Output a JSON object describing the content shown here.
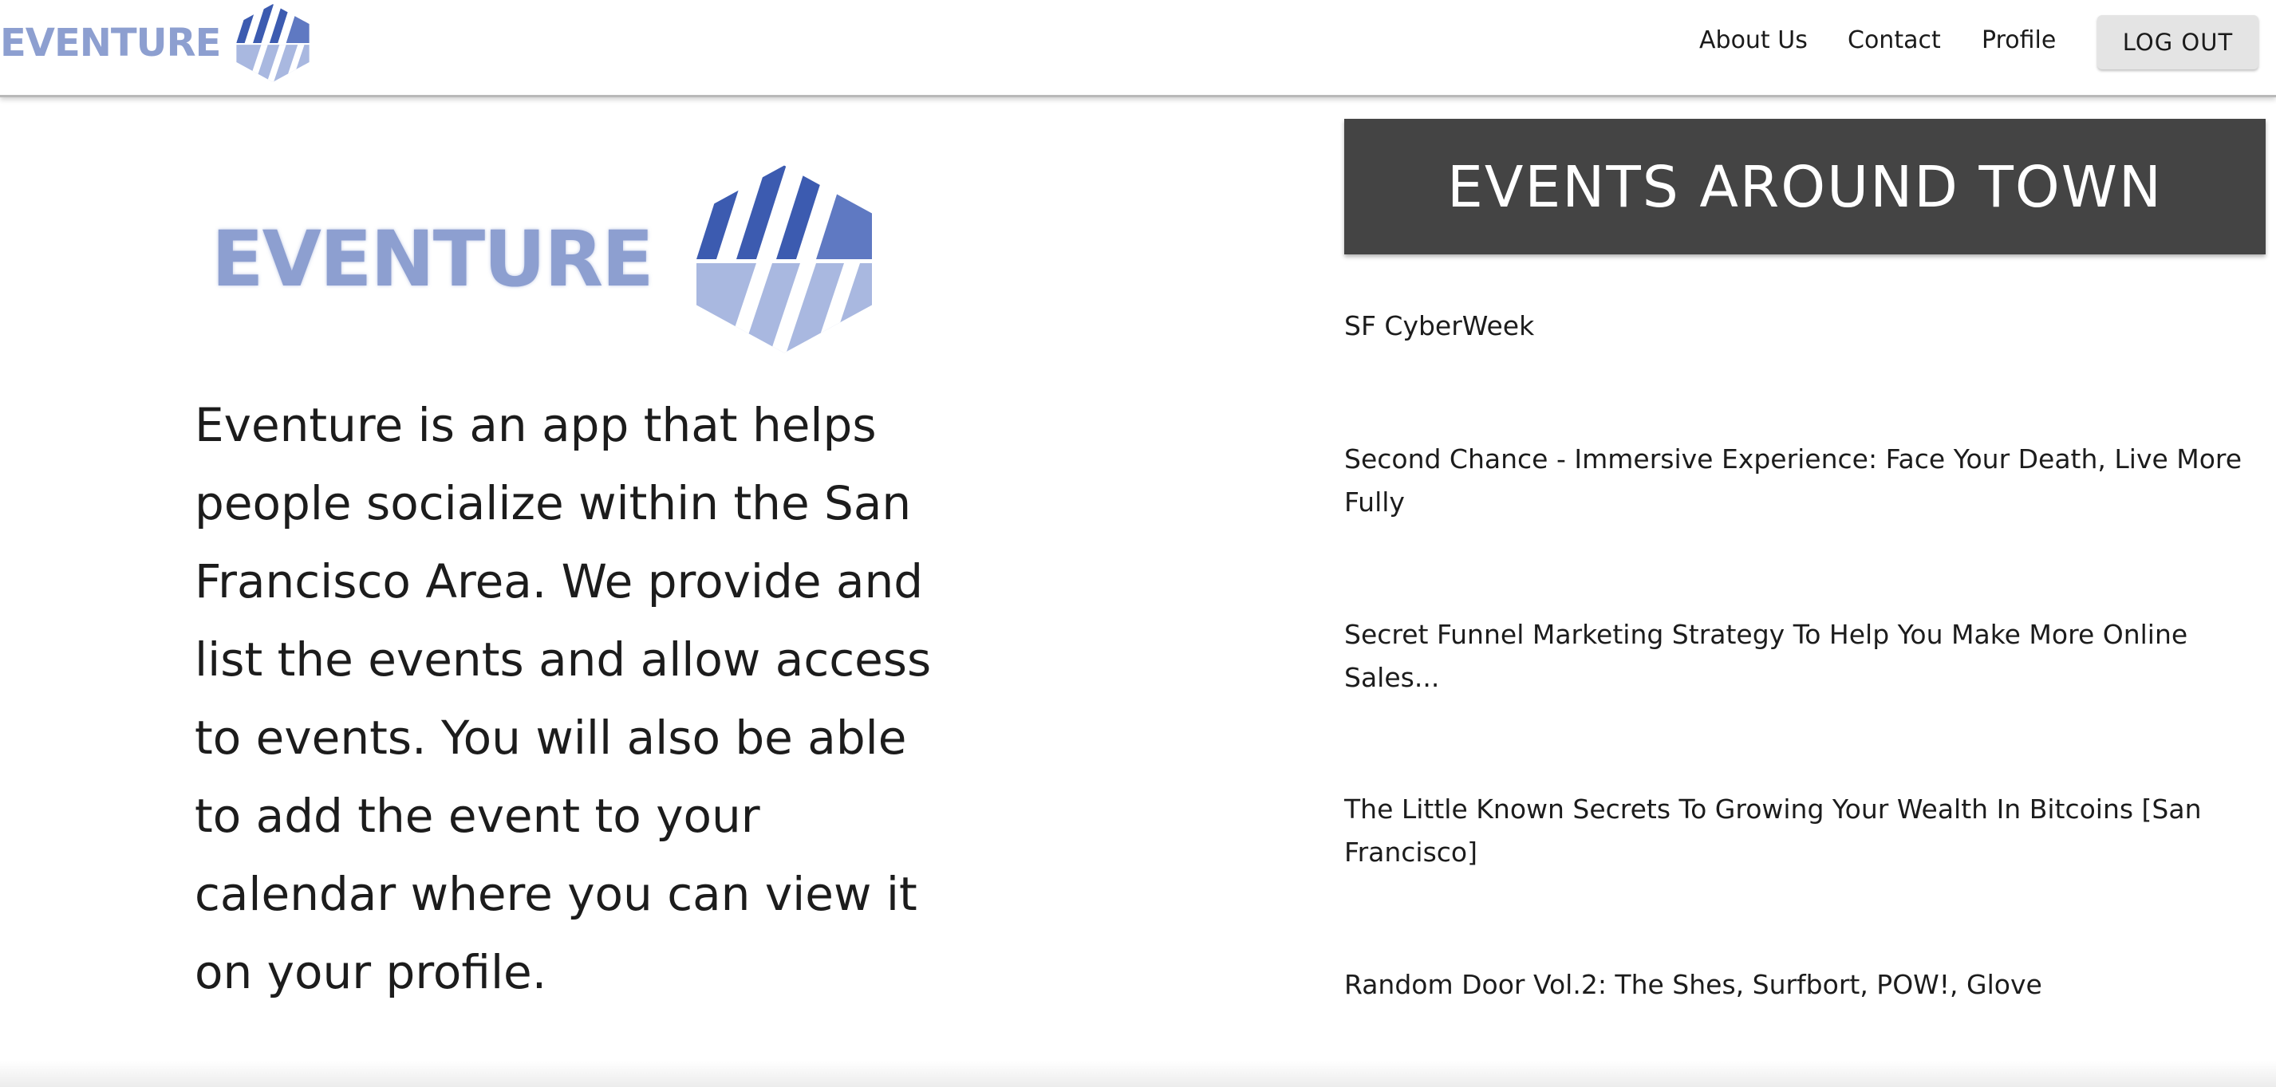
{
  "navbar": {
    "brand_text": "EVENTURE",
    "links": [
      "About Us",
      "Contact",
      "Profile"
    ],
    "logout_label": "LOG OUT"
  },
  "hero": {
    "logo_text": "EVENTURE",
    "description": "Eventure is an app that helps people socialize within the San Francisco Area. We provide and list the events and allow access to events. You will also be able to add the event to your calendar where you can view it on your profile."
  },
  "events": {
    "heading": "EVENTS AROUND TOWN",
    "items": [
      "SF CyberWeek",
      "Second Chance - Immersive Experience: Face Your Death, Live More Fully",
      "Secret Funnel Marketing Strategy To Help You Make More Online Sales...",
      "The Little Known Secrets To Growing Your Wealth In Bitcoins [San Francisco]",
      "Random Door Vol.2: The Shes, Surfbort, POW!, Glove"
    ]
  },
  "colors": {
    "brand": "#8d9fd0",
    "brand_dark": "#3c5bb0",
    "header_bg": "#444444",
    "button_bg": "#e4e4e4"
  }
}
